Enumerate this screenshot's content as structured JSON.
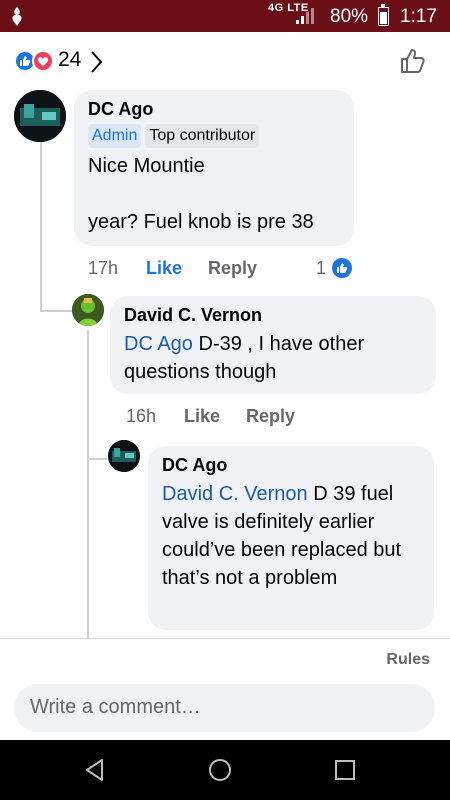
{
  "status_bar": {
    "network": "4G LTE",
    "battery": "80%",
    "time": "1:17"
  },
  "header": {
    "reaction_count": "24"
  },
  "comments": [
    {
      "author": "DC Ago",
      "badges": [
        "Admin",
        "Top contributor"
      ],
      "lines": [
        "Nice Mountie",
        "",
        "year? Fuel knob is pre 38"
      ],
      "time": "17h",
      "like": "Like",
      "reply": "Reply",
      "reactions": "1"
    },
    {
      "author": "David C. Vernon",
      "mention": "DC Ago",
      "text_after_mention": "D-39 , I have other questions though",
      "time": "16h",
      "like": "Like",
      "reply": "Reply"
    },
    {
      "author": "DC Ago",
      "mention": "David C. Vernon",
      "text_after_mention": "D 39 fuel valve is definitely earlier could’ve been replaced but that’s not a problem"
    }
  ],
  "footer": {
    "rules": "Rules",
    "comment_placeholder": "Write a comment…"
  },
  "colors": {
    "status_bar": "#6b0f16",
    "like_blue": "#1b74e4",
    "bubble": "#f0f2f5"
  }
}
